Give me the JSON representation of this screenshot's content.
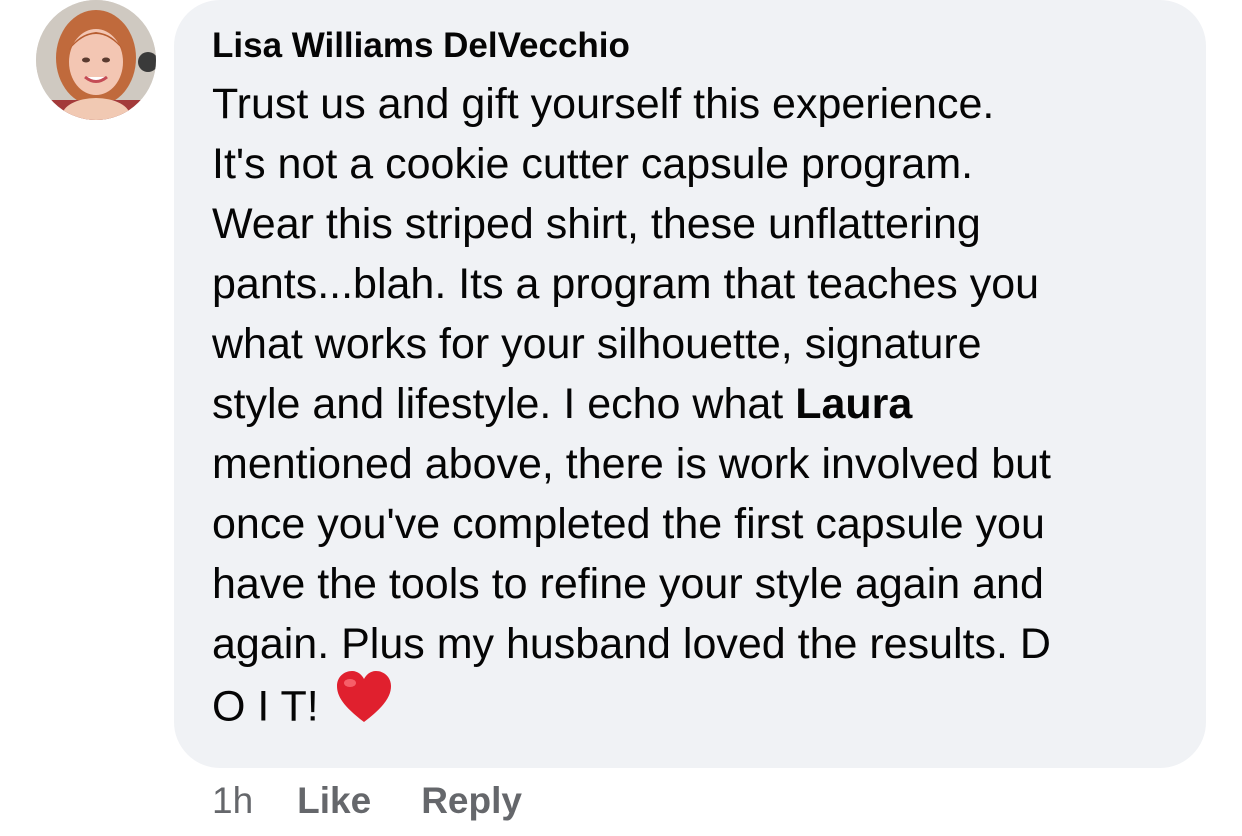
{
  "comment": {
    "author": "Lisa Williams DelVecchio",
    "lines": [
      "Trust us and gift yourself this experience.",
      "It's not a cookie cutter capsule program.",
      "Wear this striped shirt, these unflattering",
      "pants...blah.  Its a program that teaches you",
      "what works for your silhouette, signature",
      "style and lifestyle. I echo what ",
      "mentioned above, there is work involved but",
      "once you've completed the first capsule you",
      "have the tools to refine your style again and",
      "again.  Plus my husband loved the results. D",
      "O  I T! "
    ],
    "mention": "Laura",
    "emoji": "❤"
  },
  "actions": {
    "time": "1h",
    "like_label": "Like",
    "reply_label": "Reply"
  },
  "colors": {
    "bubble": "#f0f2f5",
    "text": "#050505",
    "secondary": "#65676b",
    "heart": "#e0202e"
  }
}
